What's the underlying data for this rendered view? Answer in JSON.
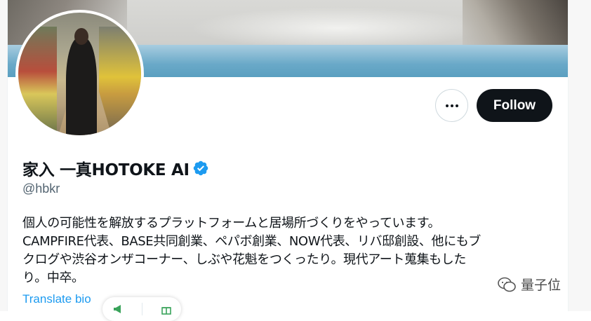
{
  "profile": {
    "display_name": "家入 一真HOTOKE AI",
    "handle": "@hbkr",
    "verified_icon": "verified-badge-icon",
    "verified_color": "#1d9bf0",
    "bio_lines": [
      "個人の可能性を解放するプラットフォームと居場所づくりをやっています。",
      "CAMPFIRE代表、BASE共同創業、ペパボ創業、NOW代表、リバ邸創設、他にもブ",
      "クログや渋谷オンザコーナー、しぶや花魁をつくったり。現代アート蒐集もした",
      "り。中卒。"
    ],
    "translate_label": "Translate bio"
  },
  "actions": {
    "more_icon": "more-dots-icon",
    "follow_label": "Follow"
  },
  "colors": {
    "follow_bg": "#0f1419",
    "link": "#1d9bf0",
    "secondary_text": "#536471"
  },
  "watermark": {
    "icon": "wechat-icon",
    "text": "量子位"
  }
}
